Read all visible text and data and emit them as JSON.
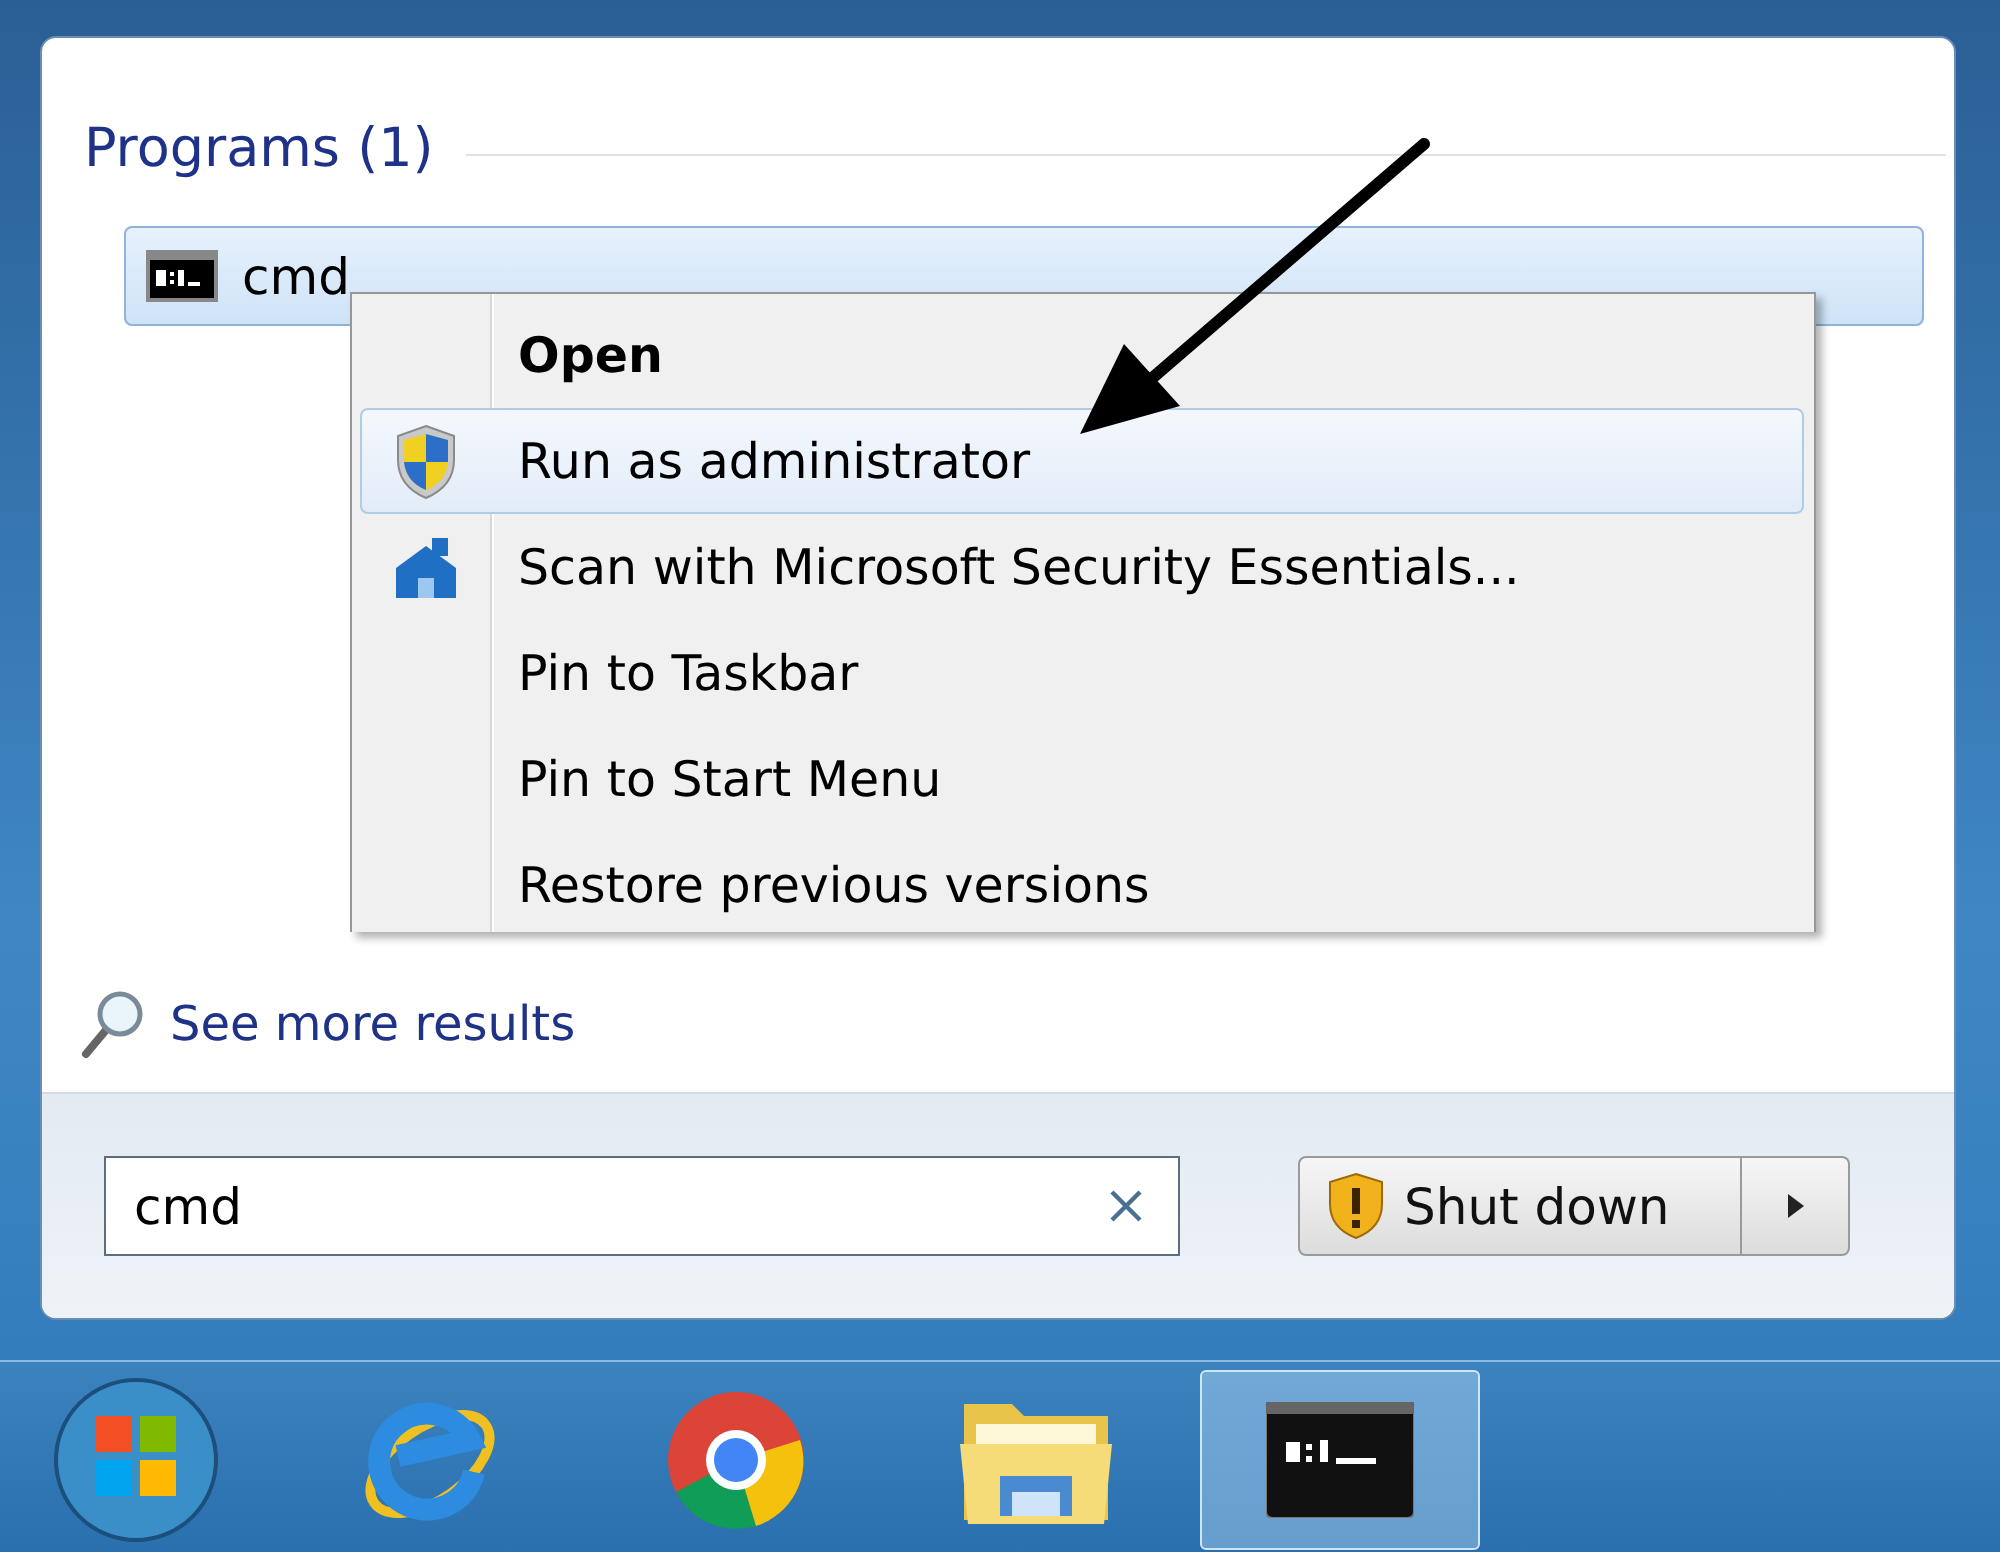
{
  "search_results": {
    "header": "Programs (1)",
    "items": [
      {
        "label": "cmd",
        "selected": true
      }
    ]
  },
  "context_menu": {
    "items": [
      {
        "label": "Open",
        "kind": "plain",
        "default": true,
        "selected": false
      },
      {
        "label": "Run as administrator",
        "kind": "shield",
        "default": false,
        "selected": true
      },
      {
        "label": "Scan with Microsoft Security Essentials...",
        "kind": "security",
        "default": false,
        "selected": false
      },
      {
        "label": "Pin to Taskbar",
        "kind": "plain",
        "default": false,
        "selected": false
      },
      {
        "label": "Pin to Start Menu",
        "kind": "plain",
        "default": false,
        "selected": false
      },
      {
        "label": "Restore previous versions",
        "kind": "plain",
        "default": false,
        "selected": false
      }
    ]
  },
  "see_more": "See more results",
  "search": {
    "value": "cmd"
  },
  "shutdown": {
    "label": "Shut down"
  },
  "taskbar": {
    "items": [
      {
        "kind": "start",
        "selected": false
      },
      {
        "kind": "ie",
        "selected": false
      },
      {
        "kind": "chrome",
        "selected": false
      },
      {
        "kind": "explorer",
        "selected": false
      },
      {
        "kind": "console",
        "selected": true
      }
    ]
  }
}
